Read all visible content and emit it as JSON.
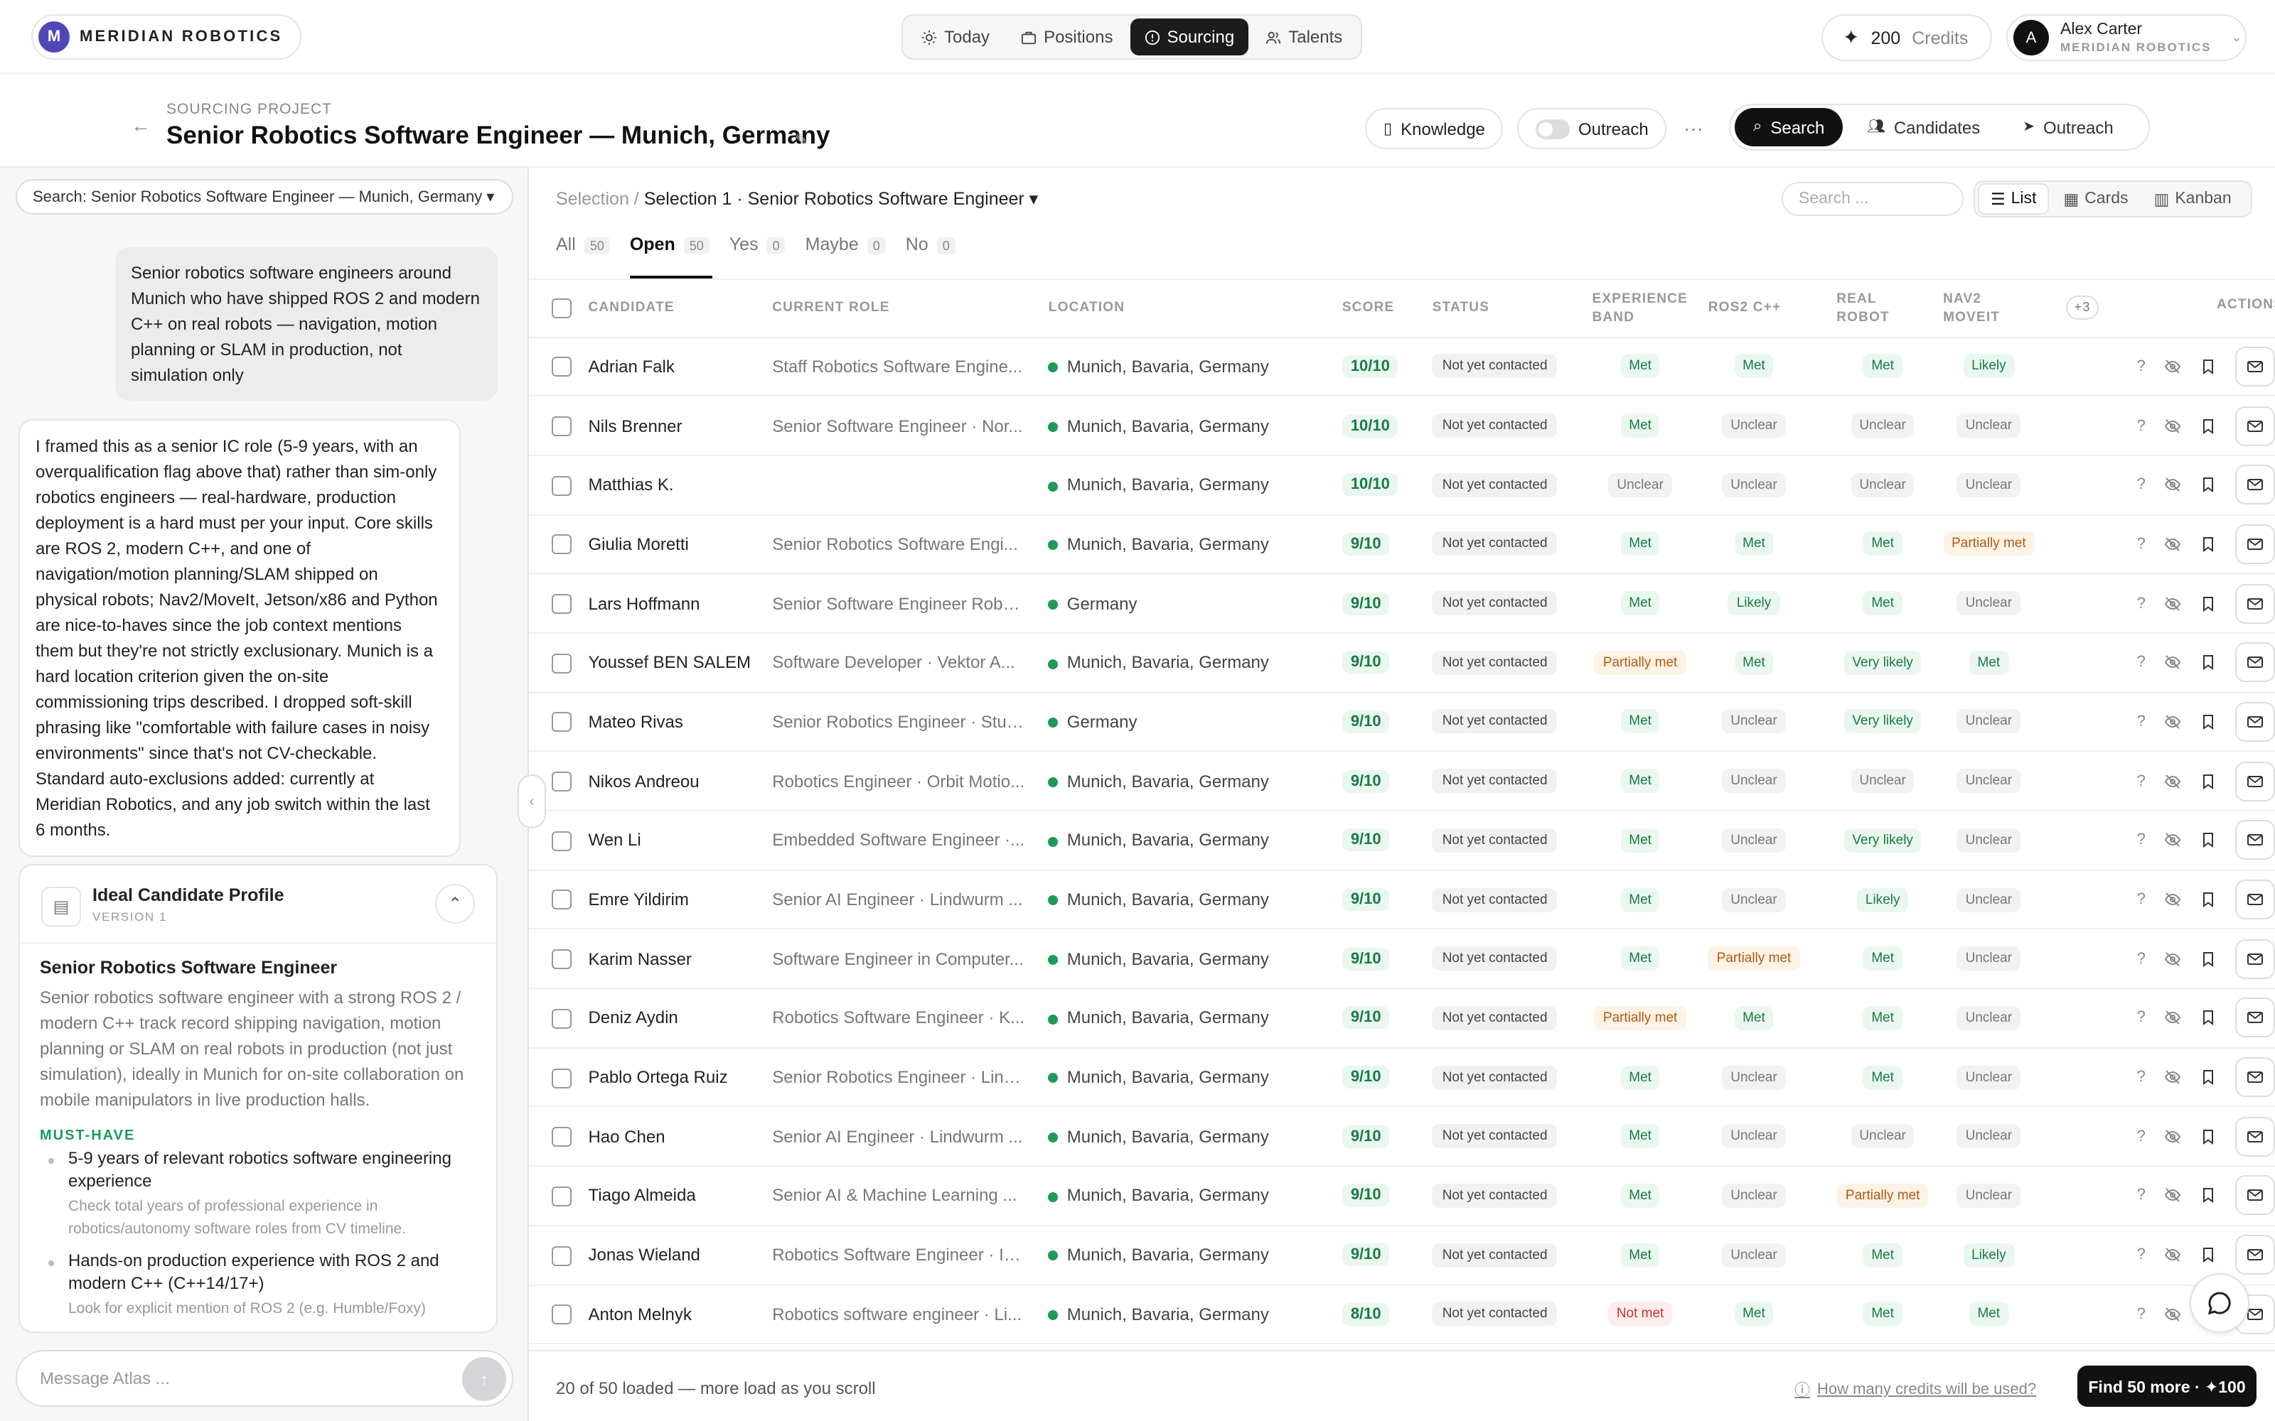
{
  "topbar": {
    "brand_initial": "M",
    "brand_name": "MERIDIAN ROBOTICS",
    "nav": [
      {
        "label": "Today",
        "icon": "sun-icon"
      },
      {
        "label": "Positions",
        "icon": "briefcase-icon"
      },
      {
        "label": "Sourcing",
        "icon": "compass-icon",
        "active": true
      },
      {
        "label": "Talents",
        "icon": "users-icon"
      }
    ],
    "credits_count": "200",
    "credits_label": "Credits",
    "user_initial": "A",
    "user_name": "Alex Carter",
    "user_org": "MERIDIAN ROBOTICS"
  },
  "project": {
    "label": "SOURCING PROJECT",
    "title": "Senior Robotics Software Engineer — Munich, Germany",
    "knowledge_label": "Knowledge",
    "outreach_toggle_label": "Outreach",
    "more_label": "···",
    "tabs": [
      {
        "label": "Search",
        "active": true
      },
      {
        "label": "Candidates"
      },
      {
        "label": "Outreach"
      }
    ]
  },
  "chat": {
    "search_pill": "Search: Senior Robotics Software Engineer — Munich, Germany ▾",
    "user_message": "Senior robotics software engineers around Munich who have shipped ROS 2 and modern C++ on real robots — navigation, motion planning or SLAM in production, not simulation only",
    "assistant_message": "I framed this as a senior IC role (5-9 years, with an overqualification flag above that) rather than sim-only robotics engineers — real-hardware, production deployment is a hard must per your input. Core skills are ROS 2, modern C++, and one of navigation/motion planning/SLAM shipped on physical robots; Nav2/MoveIt, Jetson/x86 and Python are nice-to-haves since the job context mentions them but they're not strictly exclusionary. Munich is a hard location criterion given the on-site commissioning trips described. I dropped soft-skill phrasing like \"comfortable with failure cases in noisy environments\" since that's not CV-checkable. Standard auto-exclusions added: currently at Meridian Robotics, and any job switch within the last 6 months.",
    "profile": {
      "title": "Ideal Candidate Profile",
      "version": "VERSION 1",
      "role": "Senior Robotics Software Engineer",
      "description": "Senior robotics software engineer with a strong ROS 2 / modern C++ track record shipping navigation, motion planning or SLAM on real robots in production (not just simulation), ideally in Munich for on-site collaboration on mobile manipulators in live production halls.",
      "must_have_label": "MUST-HAVE",
      "must_have": [
        {
          "title": "5-9 years of relevant robotics software engineering experience",
          "detail": "Check total years of professional experience in robotics/autonomy software roles from CV timeline."
        },
        {
          "title": "Hands-on production experience with ROS 2 and modern C++ (C++14/17+)",
          "detail": "Look for explicit mention of ROS 2 (e.g. Humble/Foxy)"
        }
      ]
    },
    "composer_placeholder": "Message Atlas ..."
  },
  "results": {
    "breadcrumb_root": "Selection /",
    "breadcrumb_current": "Selection 1 · Senior Robotics Software Engineer ▾",
    "search_placeholder": "Search ...",
    "views": [
      {
        "label": "List",
        "active": true
      },
      {
        "label": "Cards"
      },
      {
        "label": "Kanban"
      }
    ],
    "filters": [
      {
        "label": "All",
        "count": "50"
      },
      {
        "label": "Open",
        "count": "50",
        "active": true
      },
      {
        "label": "Yes",
        "count": "0"
      },
      {
        "label": "Maybe",
        "count": "0"
      },
      {
        "label": "No",
        "count": "0"
      }
    ],
    "columns": {
      "candidate": "CANDIDATE",
      "role": "CURRENT ROLE",
      "location": "LOCATION",
      "score": "SCORE",
      "status": "STATUS",
      "exp_band_1": "EXPERIENCE",
      "exp_band_2": "BAND",
      "ros": "ROS2 C++",
      "robot_1": "REAL",
      "robot_2": "ROBOT",
      "nav_1": "NAV2",
      "nav_2": "MOVEIT",
      "more": "+3",
      "actions": "ACTIONS"
    },
    "rows": [
      {
        "name": "Adrian Falk",
        "role": "Staff Robotics Software Engine...",
        "location": "Munich, Bavaria, Germany",
        "score": "10/10",
        "status": "Not yet contacted",
        "exp": "Met",
        "ros": "Met",
        "robot": "Met",
        "nav": "Likely"
      },
      {
        "name": "Nils Brenner",
        "role": "Senior Software Engineer · Nor...",
        "location": "Munich, Bavaria, Germany",
        "score": "10/10",
        "status": "Not yet contacted",
        "exp": "Met",
        "ros": "Unclear",
        "robot": "Unclear",
        "nav": "Unclear"
      },
      {
        "name": "Matthias K.",
        "role": "",
        "location": "Munich, Bavaria, Germany",
        "score": "10/10",
        "status": "Not yet contacted",
        "exp": "Unclear",
        "ros": "Unclear",
        "robot": "Unclear",
        "nav": "Unclear"
      },
      {
        "name": "Giulia Moretti",
        "role": "Senior Robotics Software Engi...",
        "location": "Munich, Bavaria, Germany",
        "score": "9/10",
        "status": "Not yet contacted",
        "exp": "Met",
        "ros": "Met",
        "robot": "Met",
        "nav": "Partially met"
      },
      {
        "name": "Lars Hoffmann",
        "role": "Senior Software Engineer Robo...",
        "location": "Germany",
        "score": "9/10",
        "status": "Not yet contacted",
        "exp": "Met",
        "ros": "Likely",
        "robot": "Met",
        "nav": "Unclear"
      },
      {
        "name": "Youssef BEN SALEM",
        "role": "Software Developer · Vektor A...",
        "location": "Munich, Bavaria, Germany",
        "score": "9/10",
        "status": "Not yet contacted",
        "exp": "Partially met",
        "ros": "Met",
        "robot": "Very likely",
        "nav": "Met"
      },
      {
        "name": "Mateo Rivas",
        "role": "Senior Robotics Engineer · Stur...",
        "location": "Germany",
        "score": "9/10",
        "status": "Not yet contacted",
        "exp": "Met",
        "ros": "Unclear",
        "robot": "Very likely",
        "nav": "Unclear"
      },
      {
        "name": "Nikos Andreou",
        "role": "Robotics Engineer · Orbit Motio...",
        "location": "Munich, Bavaria, Germany",
        "score": "9/10",
        "status": "Not yet contacted",
        "exp": "Met",
        "ros": "Unclear",
        "robot": "Unclear",
        "nav": "Unclear"
      },
      {
        "name": "Wen Li",
        "role": "Embedded Software Engineer ·...",
        "location": "Munich, Bavaria, Germany",
        "score": "9/10",
        "status": "Not yet contacted",
        "exp": "Met",
        "ros": "Unclear",
        "robot": "Very likely",
        "nav": "Unclear"
      },
      {
        "name": "Emre Yildirim",
        "role": "Senior AI Engineer · Lindwurm ...",
        "location": "Munich, Bavaria, Germany",
        "score": "9/10",
        "status": "Not yet contacted",
        "exp": "Met",
        "ros": "Unclear",
        "robot": "Likely",
        "nav": "Unclear"
      },
      {
        "name": "Karim Nasser",
        "role": "Software Engineer in Computer...",
        "location": "Munich, Bavaria, Germany",
        "score": "9/10",
        "status": "Not yet contacted",
        "exp": "Met",
        "ros": "Partially met",
        "robot": "Met",
        "nav": "Unclear"
      },
      {
        "name": "Deniz Aydin",
        "role": "Robotics Software Engineer · K...",
        "location": "Munich, Bavaria, Germany",
        "score": "9/10",
        "status": "Not yet contacted",
        "exp": "Partially met",
        "ros": "Met",
        "robot": "Met",
        "nav": "Unclear"
      },
      {
        "name": "Pablo Ortega Ruiz",
        "role": "Senior Robotics Engineer · Lind...",
        "location": "Munich, Bavaria, Germany",
        "score": "9/10",
        "status": "Not yet contacted",
        "exp": "Met",
        "ros": "Unclear",
        "robot": "Met",
        "nav": "Unclear"
      },
      {
        "name": "Hao Chen",
        "role": "Senior AI Engineer · Lindwurm ...",
        "location": "Munich, Bavaria, Germany",
        "score": "9/10",
        "status": "Not yet contacted",
        "exp": "Met",
        "ros": "Unclear",
        "robot": "Unclear",
        "nav": "Unclear"
      },
      {
        "name": "Tiago Almeida",
        "role": "Senior AI & Machine Learning ...",
        "location": "Munich, Bavaria, Germany",
        "score": "9/10",
        "status": "Not yet contacted",
        "exp": "Met",
        "ros": "Unclear",
        "robot": "Partially met",
        "nav": "Unclear"
      },
      {
        "name": "Jonas Wieland",
        "role": "Robotics Software Engineer · In...",
        "location": "Munich, Bavaria, Germany",
        "score": "9/10",
        "status": "Not yet contacted",
        "exp": "Met",
        "ros": "Unclear",
        "robot": "Met",
        "nav": "Likely"
      },
      {
        "name": "Anton Melnyk",
        "role": "Robotics software engineer · Li...",
        "location": "Munich, Bavaria, Germany",
        "score": "8/10",
        "status": "Not yet contacted",
        "exp": "Not met",
        "ros": "Met",
        "robot": "Met",
        "nav": "Met"
      }
    ],
    "action_question": "?",
    "loaded_text": "20 of 50 loaded — more load as you scroll",
    "credit_question": "How many credits will be used?",
    "find_more": "Find 50 more · ✦100"
  }
}
